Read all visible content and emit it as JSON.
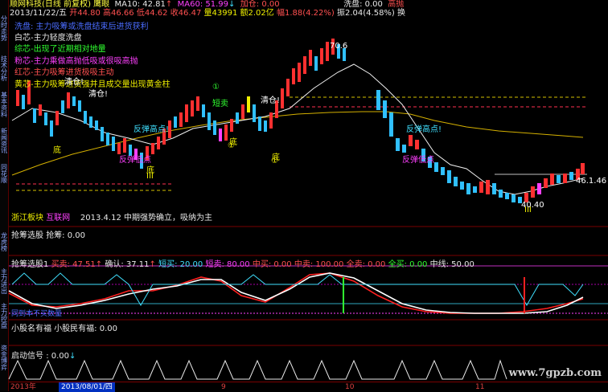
{
  "app": {
    "stock_name": "顺网科技(日线 前复权) 鹰眼",
    "ma10": "MA10: 42.81",
    "ma10_arrow": "↑",
    "ma60": "MA60: 51.99",
    "ma60_arrow": "↓",
    "jiacang": "加仓: 0.00",
    "xipan": "洗盘: 0.00",
    "gaopao": "高抛",
    "date": "2013/11/22/五",
    "open": "开44.80",
    "high": "高46.66",
    "low": "低44.62",
    "close": "收46.47",
    "volume": "量43991",
    "amount": "额2.02亿",
    "change": "幅1.88(4.22%)",
    "amplitude": "振2.04(4.58%)",
    "turnover": "换"
  },
  "legend": [
    {
      "text": "洗盘: 主力吸筹或洗盘结束后进货获利",
      "color": "#4a6cff"
    },
    {
      "text": "白芯-主力轻度洗盘",
      "color": "#e8e8e8"
    },
    {
      "text": "综芯-出现了近期相对地量",
      "color": "#30ff30"
    },
    {
      "text": "粉芯-主力乘做高抛低吸或很吸高抛",
      "color": "#ff40ff"
    },
    {
      "text": "红芯-主力吸筹进货极吸主动",
      "color": "#ff5050"
    },
    {
      "text": "黄芯-主力吸筹进货强并且成交量出现黄金柱",
      "color": "#f0f000"
    }
  ],
  "chart_markers": {
    "qingcang1": "清仓!",
    "qingcang2": "清仓!",
    "qingcang3": "清仓!",
    "duanmai": "短卖",
    "circle1": "①",
    "circle2": "①",
    "circle3": "①",
    "fantan_gaodian1": "反弹高点!",
    "fantan_gaodian2": "反弹高点!",
    "fantan_didian1": "反弹低点",
    "fantan_didian2": "反弹低点",
    "di1": "底",
    "di2": "底",
    "di3": "底",
    "di4": "底",
    "num_iii1": "III",
    "num_iii2": "III",
    "peak_price": "70.6",
    "low_price": "40.40",
    "last_price": "46.1.46"
  },
  "bottom_note": {
    "tag1": "浙江板块",
    "tag2": "互联网",
    "text": "2013.4.12 中期强势确立，吸纳为主"
  },
  "pane2": {
    "title": "抢筹选股",
    "value": "抢筹: 0.00"
  },
  "pane3": {
    "title": "抢筹选股1",
    "maimai": "买卖: 47.51",
    "maimai_arrow": "↑",
    "queren": "确认: 37.11",
    "queren_arrow": "↑",
    "duanbuy": "短买: 20.00",
    "duansell": "短卖: 80.00",
    "zhongmai": "中买: 0.00",
    "zhongsell": "中卖: 100.00",
    "quansell": "全卖: 0.00",
    "quanbuy": "全买: 0.00",
    "midline": "中线: 50.00",
    "note": "同到本不买数量"
  },
  "pane4": {
    "title": "小股名有福",
    "value": "小股民有福: 0.00"
  },
  "pane5": {
    "title": "启动信号",
    "value": "0.00",
    "arrow": "↓"
  },
  "date_axis": {
    "year": "2013年",
    "cursor_date": "2013/08/01/四",
    "tick9": "9",
    "tick10": "10",
    "tick11": "11"
  },
  "watermark": "www.7gpzb.com",
  "sidebar_tabs": [
    "分时走势",
    "技术分析",
    "基本资料",
    "新闻资讯",
    "同花顺",
    "龙虎榜",
    "主力进出",
    "主力控盘",
    "资金博弈"
  ],
  "colors": {
    "bg": "#000000",
    "up": "#ff3030",
    "down": "#30c0ff",
    "border": "#7a0000"
  }
}
